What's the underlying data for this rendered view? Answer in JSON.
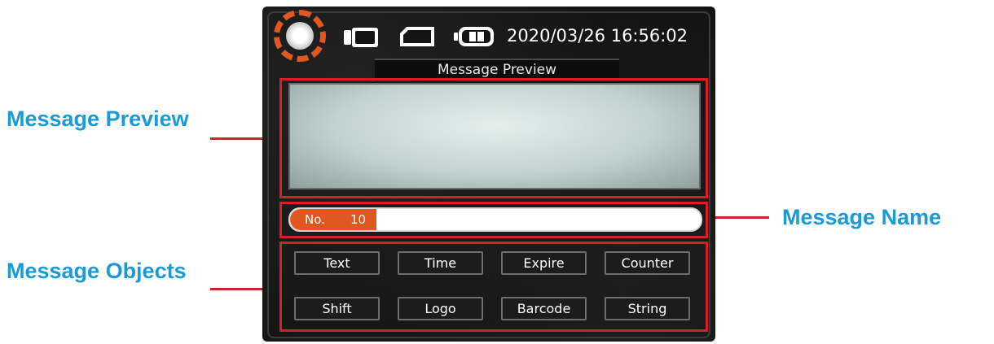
{
  "callouts": {
    "message_preview": "Message Preview",
    "message_name": "Message Name",
    "message_objects": "Message Objects"
  },
  "status": {
    "datetime": "2020/03/26 16:56:02",
    "icons": [
      "logo-icon",
      "device-icon",
      "card-icon",
      "battery-icon"
    ]
  },
  "preview": {
    "title": "Message Preview"
  },
  "message_name": {
    "label": "No.",
    "number": "10",
    "name": ""
  },
  "objects": {
    "row1": [
      "Text",
      "Time",
      "Expire",
      "Counter"
    ],
    "row2": [
      "Shift",
      "Logo",
      "Barcode",
      "String"
    ]
  },
  "colors": {
    "accent_orange": "#e0581f",
    "highlight_red": "#d81f26",
    "callout_blue": "#1a9ad6",
    "screen_bg": "#141414"
  }
}
